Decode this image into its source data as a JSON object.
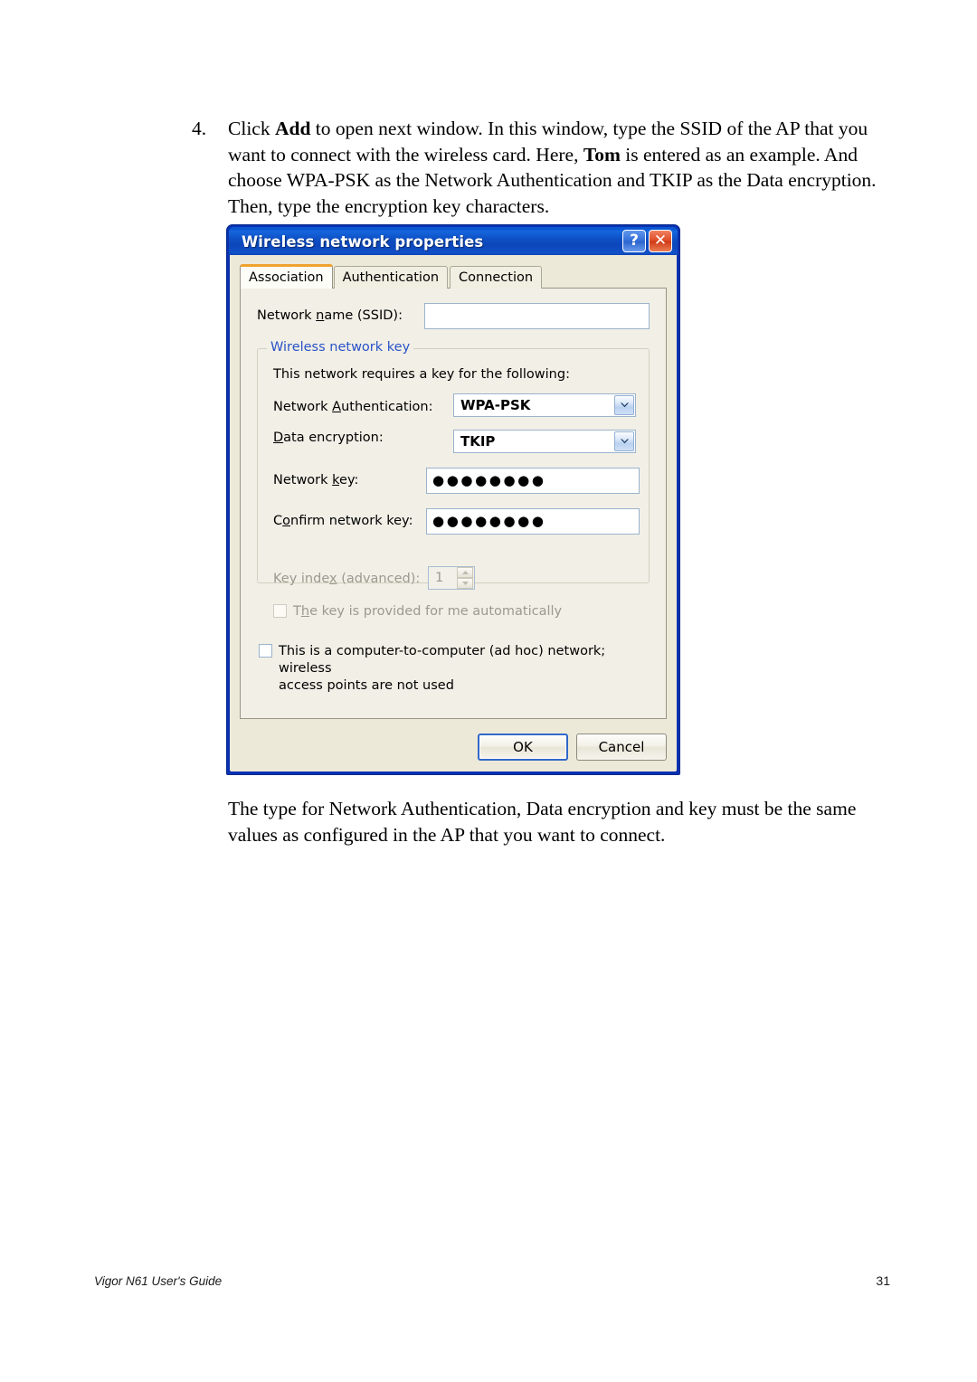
{
  "document": {
    "step": {
      "number": "4.",
      "text_html": "Click <b>Add</b> to open next window. In this window, type the SSID of the AP that you want to connect with the wireless card. Here, <b>Tom</b> is entered as an example. And choose WPA-PSK as the Network Authentication and TKIP as the Data encryption. Then, type the encryption key characters.",
      "text_plain": "Click Add to open next window. In this window, type the SSID of the AP that you want to connect with the wireless card. Here, Tom is entered as an example. And choose WPA-PSK as the Network Authentication and TKIP as the Data encryption. Then, type the encryption key characters."
    },
    "note": "The type for Network Authentication, Data encryption and key must be the same values as configured in the AP that you want to connect."
  },
  "footer": {
    "guide_title": "Vigor N61 User's Guide",
    "page_number": "31"
  },
  "dialog": {
    "title": "Wireless network properties",
    "title_buttons": [
      {
        "name": "help-button",
        "glyph": "?"
      },
      {
        "name": "close-button",
        "glyph": "✕"
      }
    ],
    "tabs": [
      {
        "label": "Association",
        "active": true
      },
      {
        "label": "Authentication",
        "active": false
      },
      {
        "label": "Connection",
        "active": false
      }
    ],
    "ssid": {
      "label": "Network name (SSID):",
      "label_pre": "Network ",
      "label_accel": "n",
      "label_post": "ame (SSID):",
      "value": "",
      "placeholder": ""
    },
    "group": {
      "legend": "Wireless network key",
      "note": "This network requires a key for the following:",
      "network_authentication": {
        "label_pre": "Network ",
        "label_accel": "A",
        "label_post": "uthentication:",
        "label": "Network Authentication:",
        "value": "WPA-PSK",
        "options": [
          "WPA-PSK"
        ]
      },
      "data_encryption": {
        "label_pre": "",
        "label_accel": "D",
        "label_post": "ata encryption:",
        "label": "Data encryption:",
        "value": "TKIP",
        "options": [
          "TKIP"
        ]
      },
      "network_key": {
        "label_pre": "Network ",
        "label_accel": "k",
        "label_post": "ey:",
        "label": "Network key:",
        "value": "●●●●●●●●",
        "char_count": 8
      },
      "confirm_network_key": {
        "label_pre": "C",
        "label_accel": "o",
        "label_post": "nfirm network key:",
        "label": "Confirm network key:",
        "value": "●●●●●●●●",
        "char_count": 8
      },
      "key_index": {
        "label_pre": "Key inde",
        "label_accel": "x",
        "label_post": " (advanced):",
        "label": "Key index (advanced):",
        "value": "1",
        "disabled": true
      },
      "auto_key": {
        "label_pre": "T",
        "label_accel": "h",
        "label_post": "e key is provided for me automatically",
        "label": "The key is provided for me automatically",
        "checked": false,
        "disabled": true
      }
    },
    "adhoc": {
      "label_pre": "This is a ",
      "label_accel": "c",
      "label_post": "omputer-to-computer (ad hoc) network; wireless access points are not used",
      "label_line1": "This is a computer-to-computer (ad hoc) network; wireless",
      "label_line2": "access points are not used",
      "checked": false
    },
    "buttons": {
      "ok": "OK",
      "cancel": "Cancel"
    },
    "colors": {
      "titlebar_blue": "#0c59d6",
      "frame_blue": "#0a31b0",
      "dialog_face": "#ece9d8",
      "panel_face": "#f1efe6",
      "active_tab_accent": "#f0a22e",
      "legend_blue": "#2a53c8",
      "disabled_text": "#9c9a8f"
    }
  }
}
